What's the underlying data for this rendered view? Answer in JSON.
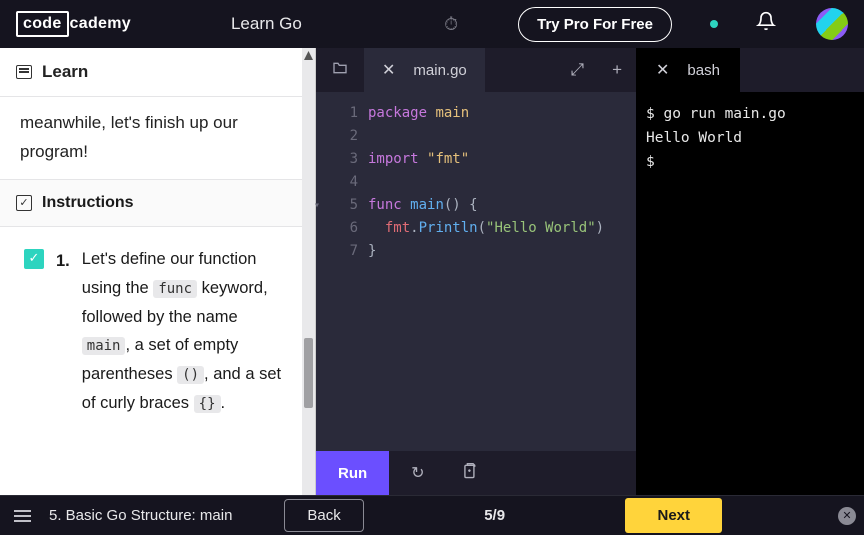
{
  "header": {
    "logo_prefix": "code",
    "logo_suffix": "cademy",
    "course": "Learn Go",
    "try_pro": "Try Pro For Free"
  },
  "sidebar": {
    "learn_label": "Learn",
    "paragraph": "meanwhile, let's finish up our program!",
    "instructions_label": "Instructions",
    "step": {
      "num": "1.",
      "p1": "Let's define our function using the ",
      "c1": "func",
      "p2": " keyword, followed by the name ",
      "c2": "main",
      "p3": ", a set of empty parentheses ",
      "c3": "()",
      "p4": ", and a set of curly braces ",
      "c4": "{}",
      "p5": "."
    }
  },
  "editor": {
    "tab": "main.go",
    "lines": [
      "1",
      "2",
      "3",
      "4",
      "5",
      "6",
      "7"
    ],
    "l1a": "package",
    "l1b": "main",
    "l3a": "import",
    "l3b": "\"fmt\"",
    "l5a": "func",
    "l5b": "main",
    "l5c": "()",
    "l5d": " {",
    "l6a": "fmt",
    "l6b": ".",
    "l6c": "Println",
    "l6d": "(",
    "l6e": "\"Hello World\"",
    "l6f": ")",
    "l7": "}",
    "run": "Run"
  },
  "terminal": {
    "tab": "bash",
    "line1": "$ go run main.go",
    "line2": "Hello World",
    "line3": "$"
  },
  "bottom": {
    "lesson": "5. Basic Go Structure: main",
    "back": "Back",
    "progress": "5/9",
    "next": "Next"
  }
}
